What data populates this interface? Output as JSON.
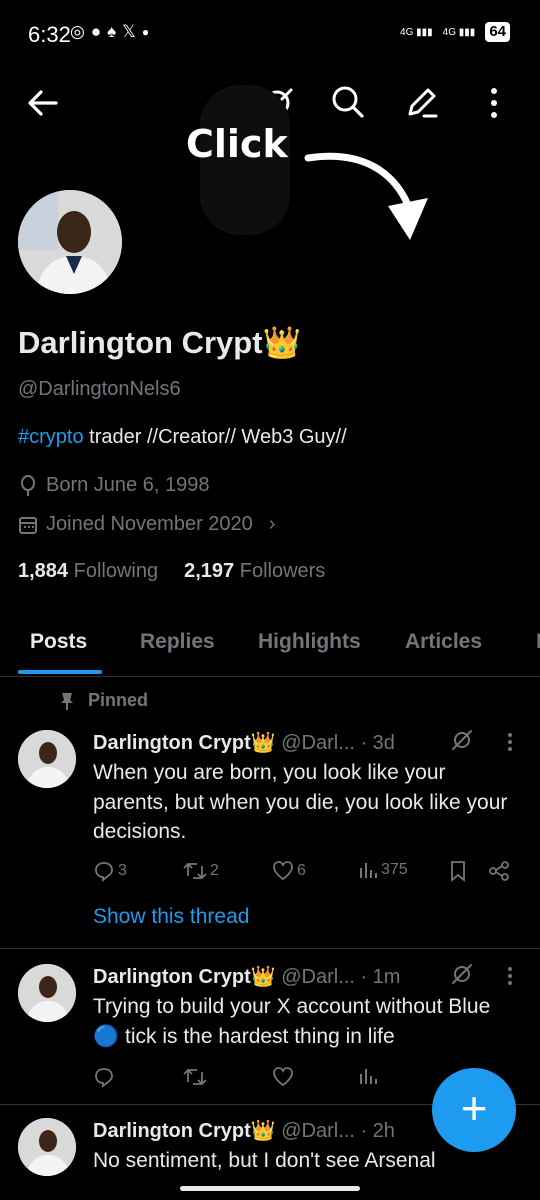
{
  "status_bar": {
    "time": "6:32",
    "network1": "4G",
    "network2": "4G",
    "battery": "64"
  },
  "annotation": {
    "click_text": "Click"
  },
  "profile": {
    "name": "Darlington Crypt👑",
    "handle": "@DarlingtonNels6",
    "bio_hashtag": "#crypto",
    "bio_rest": " trader //Creator// Web3 Guy//",
    "born": "Born June 6, 1998",
    "joined": "Joined November 2020",
    "following_count": "1,884",
    "following_label": "Following",
    "followers_count": "2,197",
    "followers_label": "Followers"
  },
  "tabs": [
    {
      "label": "Posts"
    },
    {
      "label": "Replies"
    },
    {
      "label": "Highlights"
    },
    {
      "label": "Articles"
    },
    {
      "label": "M"
    }
  ],
  "feed": {
    "pinned_label": "Pinned",
    "show_thread": "Show this thread",
    "tweets": [
      {
        "name": "Darlington Crypt👑",
        "handle": "@Darl...",
        "time": "· 3d",
        "text": "When you are born, you look like your parents, but when you die, you look like your decisions.",
        "replies": "3",
        "reposts": "2",
        "likes": "6",
        "views": "375"
      },
      {
        "name": "Darlington Crypt👑",
        "handle": "@Darl...",
        "time": "· 1m",
        "text": "Trying to build your X account without Blue 🔵 tick is the hardest thing in life"
      },
      {
        "name": "Darlington Crypt👑",
        "handle": "@Darl...",
        "time": "· 2h",
        "text": "No sentiment, but I don't see Arsenal"
      }
    ]
  },
  "colors": {
    "accent": "#1d9bf0",
    "background": "#000000",
    "muted": "#71767b"
  },
  "fab": {
    "label": "+"
  }
}
